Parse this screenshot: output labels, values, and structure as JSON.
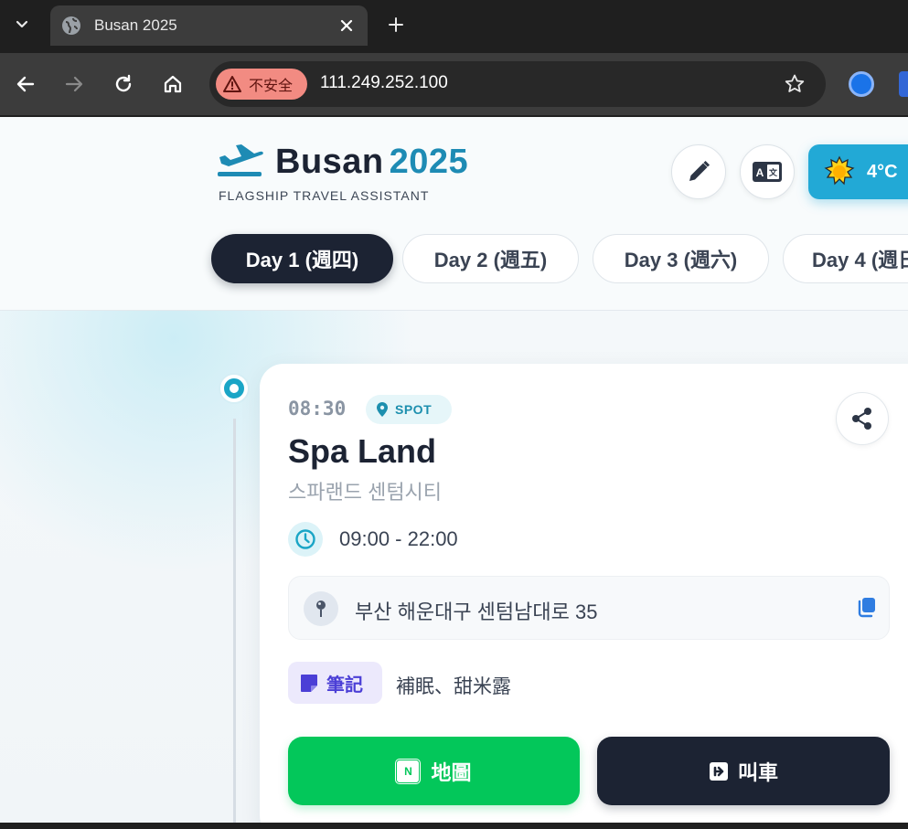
{
  "browser": {
    "tab_title": "Busan 2025",
    "security_label": "不安全",
    "url": "111.249.252.100"
  },
  "header": {
    "brand_name": "Busan",
    "brand_year": "2025",
    "tagline": "FLAGSHIP TRAVEL ASSISTANT",
    "weather_temp": "4°C"
  },
  "day_tabs": [
    {
      "label": "Day 1 (週四)",
      "active": true
    },
    {
      "label": "Day 2 (週五)",
      "active": false
    },
    {
      "label": "Day 3 (週六)",
      "active": false
    },
    {
      "label": "Day 4 (週日",
      "active": false
    }
  ],
  "card": {
    "time": "08:30",
    "type_badge": "SPOT",
    "name": "Spa Land",
    "local_name": "스파랜드 센텀시티",
    "hours": "09:00 - 22:00",
    "address": "부산 해운대구 센텀남대로 35",
    "note_label": "筆記",
    "note_text": "補眠、甜米露",
    "map_button": "地圖",
    "map_logo": "N",
    "taxi_button": "叫車"
  },
  "colors": {
    "navy": "#1c2333",
    "accent_teal": "#1aa5c6",
    "brand_year": "#1e8bb4",
    "naver_green": "#03c75a",
    "note_purple": "#4b3fd6",
    "weather_bg": "#22a9d6"
  }
}
